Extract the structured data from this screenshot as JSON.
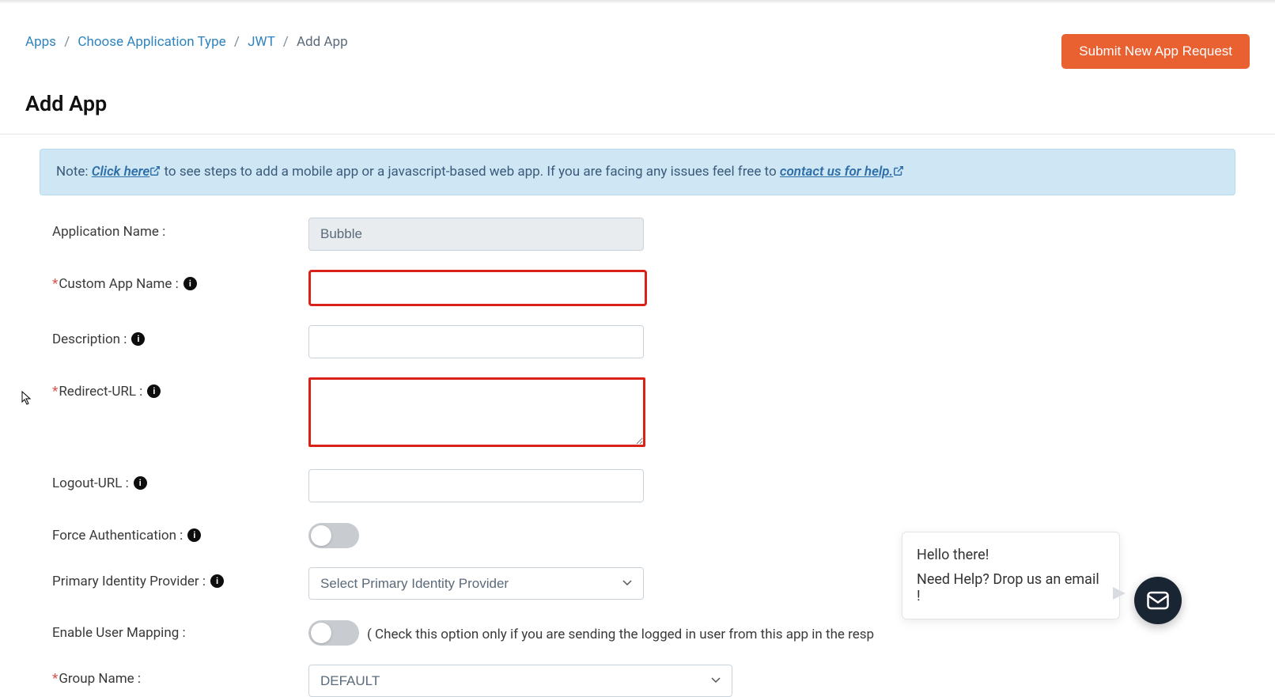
{
  "breadcrumb": {
    "apps": "Apps",
    "choose": "Choose Application Type",
    "jwt": "JWT",
    "current": "Add App"
  },
  "header": {
    "submit_btn": "Submit New App Request"
  },
  "page_title": "Add App",
  "note": {
    "prefix": "Note: ",
    "click_here": "Click here",
    "mid": " to see steps to add a mobile app or a javascript-based web app. If you are facing any issues feel free to ",
    "contact": "contact us for help."
  },
  "form": {
    "application_name": {
      "label": "Application Name :",
      "value": "Bubble"
    },
    "custom_app_name": {
      "label": "Custom App Name :",
      "value": ""
    },
    "description": {
      "label": "Description :",
      "value": ""
    },
    "redirect_url": {
      "label": "Redirect-URL :",
      "value": ""
    },
    "logout_url": {
      "label": "Logout-URL :",
      "value": ""
    },
    "force_auth": {
      "label": "Force Authentication :"
    },
    "primary_idp": {
      "label": "Primary Identity Provider :",
      "placeholder": "Select Primary Identity Provider"
    },
    "enable_mapping": {
      "label": "Enable User Mapping :",
      "hint": "( Check this option only if you are sending the logged in user from this app in the resp"
    },
    "group_name": {
      "label": "Group Name :",
      "value": "DEFAULT"
    }
  },
  "chat": {
    "line1": "Hello there!",
    "line2": "Need Help? Drop us an email !"
  }
}
